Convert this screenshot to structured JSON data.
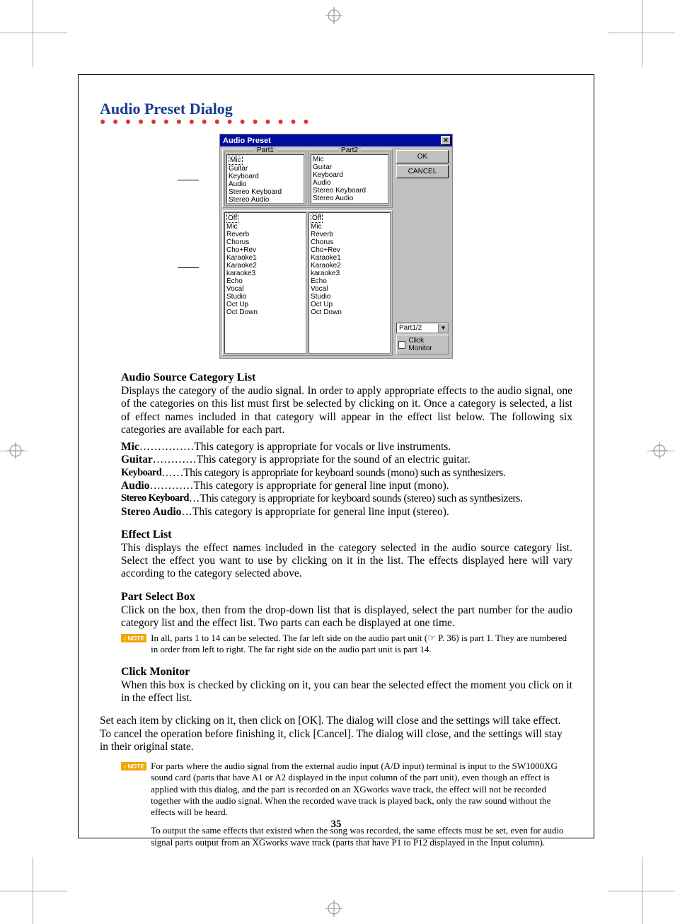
{
  "heading": "Audio Preset Dialog",
  "dialog": {
    "title": "Audio Preset",
    "part1_label": "Part1",
    "part2_label": "Part2",
    "categories": [
      "Mic",
      "Guitar",
      "Keyboard",
      "Audio",
      "Stereo Keyboard",
      "Stereo Audio"
    ],
    "effects": [
      "Off",
      "Mic",
      "Reverb",
      "Chorus",
      "Cho+Rev",
      "Karaoke1",
      "Karaoke2",
      "karaoke3",
      "Echo",
      "Vocal",
      "Studio",
      "Oct Up",
      "Oct Down"
    ],
    "ok": "OK",
    "cancel": "CANCEL",
    "part_select": "Part1/2",
    "click_monitor": "Click Monitor"
  },
  "sections": {
    "cat_head": "Audio Source Category List",
    "cat_body": "Displays the category of the audio signal. In order to apply appropriate effects to the audio signal, one of the categories on this list must first be selected by clicking on it. Once a category is selected, a list of effect names included in that category will appear in the effect list below. The following six categories are available for each part.",
    "defs": [
      {
        "label": "Mic",
        "dots": " ……………",
        "desc": "This category is appropriate for vocals or live instruments."
      },
      {
        "label": "Guitar",
        "dots": " …………",
        "desc": "This category is appropriate for the sound of an electric guitar."
      },
      {
        "label": "Keyboard",
        "dots": "  ……",
        "desc": "This category is appropriate for keyboard sounds (mono) such as synthesizers.",
        "condensed": true
      },
      {
        "label": "Audio",
        "dots": " …………",
        "desc": "This category is appropriate for general line input (mono)."
      },
      {
        "label": "Stereo Keyboard",
        "dots": " …",
        "desc": "This category is appropriate for keyboard sounds (stereo) such as synthesizers.",
        "condensed": true
      },
      {
        "label": "Stereo Audio",
        "dots": "  …",
        "desc": "This category is appropriate for general line input (stereo)."
      }
    ],
    "eff_head": "Effect List",
    "eff_body": "This displays the effect names included in the category selected in the audio source category list. Select the effect you want to use by clicking on it in the list. The effects displayed here will vary according to the category selected above.",
    "ps_head": "Part Select Box",
    "ps_body": "Click on the box, then from the drop-down list that is displayed, select the part number for the audio category list and the effect list. Two parts can each be displayed at one time.",
    "ps_note": "In all, parts 1 to 14 can be selected. The far left side on the audio part unit (☞ P. 36) is part 1. They are numbered in order from left to right. The far right side on the audio part unit is part 14.",
    "cm_head": "Click Monitor",
    "cm_body": "When this box is checked by clicking on it, you can hear the selected effect the moment you click on it in the effect list.",
    "closing": "Set each item by clicking on it, then click on [OK]. The dialog will close and the settings will take effect. To cancel the operation before finishing it, click [Cancel]. The dialog will close, and the settings will stay in their original state.",
    "note2a": "For parts where the audio signal from the external audio input (A/D input) terminal is input to the SW1000XG sound card (parts that have A1 or A2 displayed in the input column of the part unit), even though an effect is applied with this dialog, and the part is recorded on an XGworks wave track, the effect will not be recorded together with the audio signal. When the recorded wave track is played back, only the raw sound without the effects will be heard.",
    "note2b": "To output the same effects that existed when the song was recorded, the same effects must be set, even for audio signal parts output from an XGworks wave track (parts that have P1 to P12 displayed in the Input column)."
  },
  "note_label": "NOTE",
  "page_number": "35"
}
